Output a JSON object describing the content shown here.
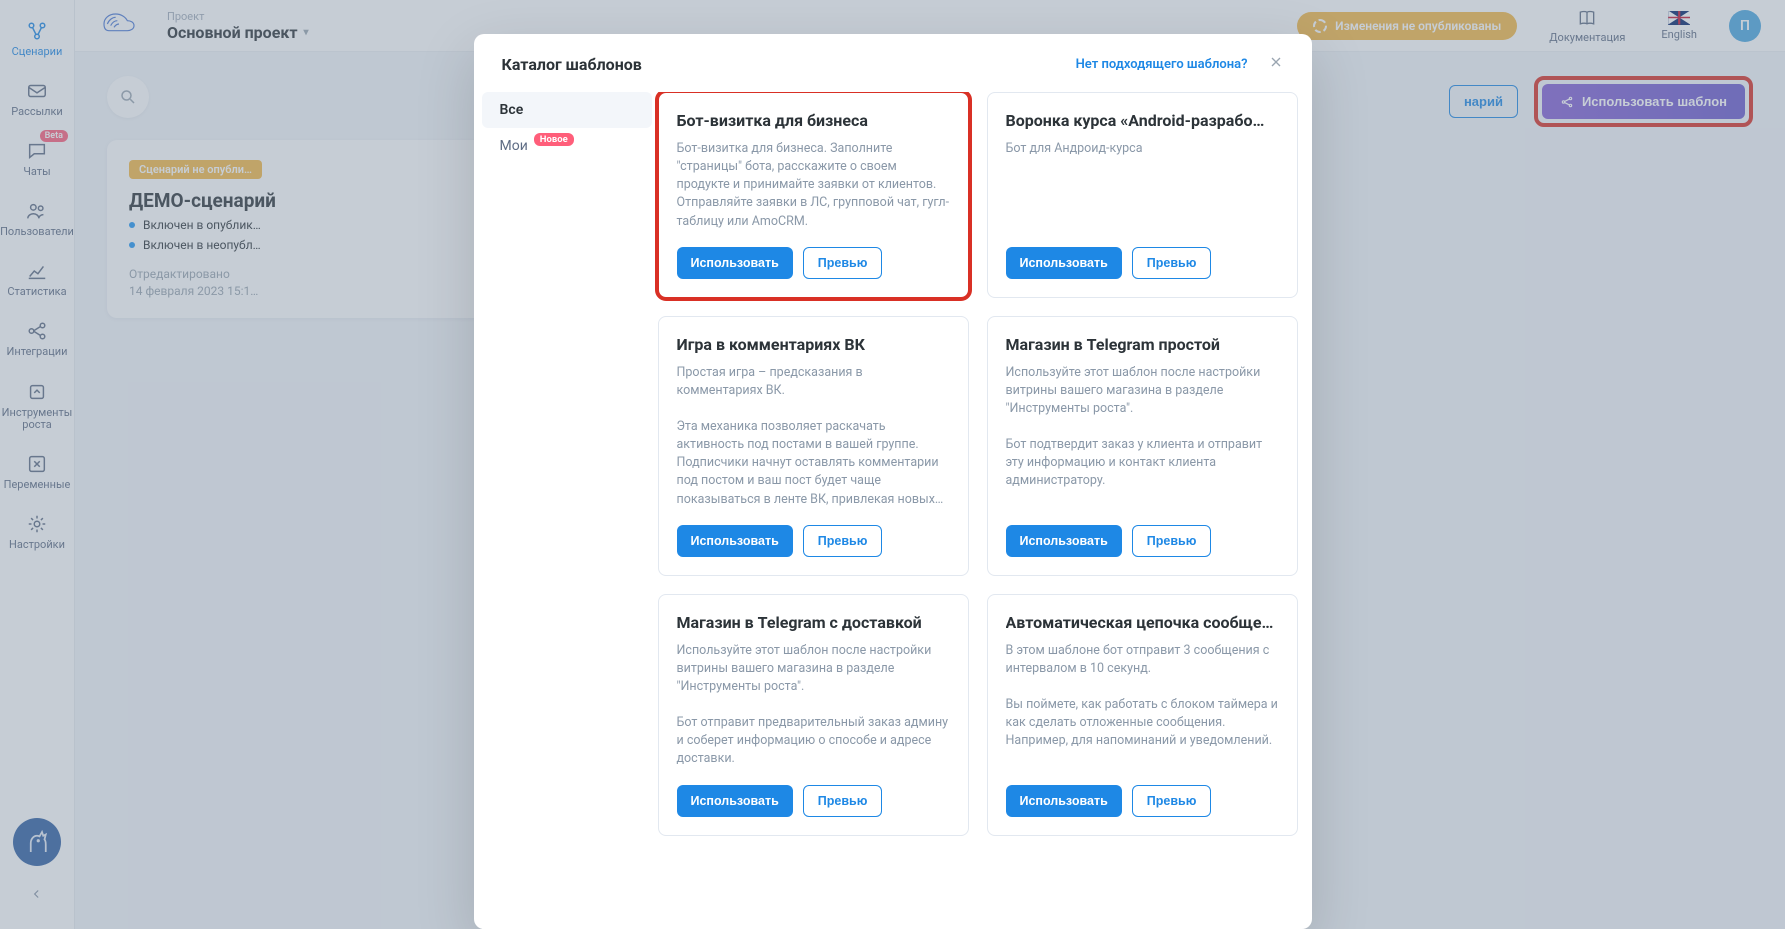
{
  "topbar": {
    "project_label": "Проект",
    "project_name": "Основной проект",
    "warn_text": "Изменения не опубликованы",
    "docs_label": "Документация",
    "lang_label": "English",
    "avatar_letter": "П"
  },
  "nav": {
    "scenarios": "Сценарии",
    "broadcasts": "Рассылки",
    "chats": "Чаты",
    "chats_badge": "Beta",
    "users": "Пользователи",
    "stats": "Статистика",
    "integrations": "Интеграции",
    "growth_tools": "Инструменты\nроста",
    "variables": "Переменные",
    "settings": "Настройки"
  },
  "content_area": {
    "status_pill": "Сценарий не опубли…",
    "title": "ДЕМО-сценарий",
    "line1": "Включен в опублик…",
    "line2": "Включен в неопубл…",
    "edited_label": "Отредактировано",
    "edited_val": "14 февраля 2023 15:1…",
    "btn_new_scenario": "нарий",
    "btn_use_template": "Использовать шаблон"
  },
  "modal": {
    "title": "Каталог шаблонов",
    "no_template_link": "Нет подходящего шаблона?",
    "tabs": {
      "all": "Все",
      "mine": "Мои",
      "mine_badge": "Новое"
    },
    "use_label": "Использовать",
    "preview_label": "Превью",
    "cards": [
      {
        "title": "Бот-визитка для бизнеса",
        "desc": "Бот-визитка для бизнеса. Заполните \"страницы\" бота, расскажите о своем продукте и принимайте заявки от клиентов.\nОтправляйте заявки в ЛС, групповой чат, гугл-таблицу или AmoCRM.",
        "highlight": true
      },
      {
        "title": "Воронка курса «Android-разрабо…",
        "desc": "Бот для Андроид-курса"
      },
      {
        "title": "Игра в комментариях ВК",
        "desc": "Простая игра – предсказания в комментариях ВК.\n\nЭта механика позволяет раскачать активность под постами в вашей группе. Подписчики начнут оставлять комментарии под постом и ваш пост будет чаще показываться в ленте ВК, привлекая новых…"
      },
      {
        "title": "Магазин в Telegram простой",
        "desc": "Используйте этот шаблон после настройки витрины вашего магазина в разделе \"Инструменты роста\".\n\nБот подтвердит заказ у клиента и отправит эту информацию и контакт клиента администратору."
      },
      {
        "title": "Магазин в Telegram с доставкой",
        "desc": "Используйте этот шаблон после настройки витрины вашего магазина в разделе \"Инструменты роста\".\n\nБот отправит предварительный заказ админу и соберет информацию о способе и адресе доставки."
      },
      {
        "title": "Автоматическая цепочка сообще…",
        "desc": "В этом шаблоне бот отправит 3 сообщения с интервалом в 10 секунд.\n\nВы поймете, как работать с блоком таймера и как сделать отложенные сообщения. Например, для напоминаний и уведомлений."
      }
    ]
  }
}
